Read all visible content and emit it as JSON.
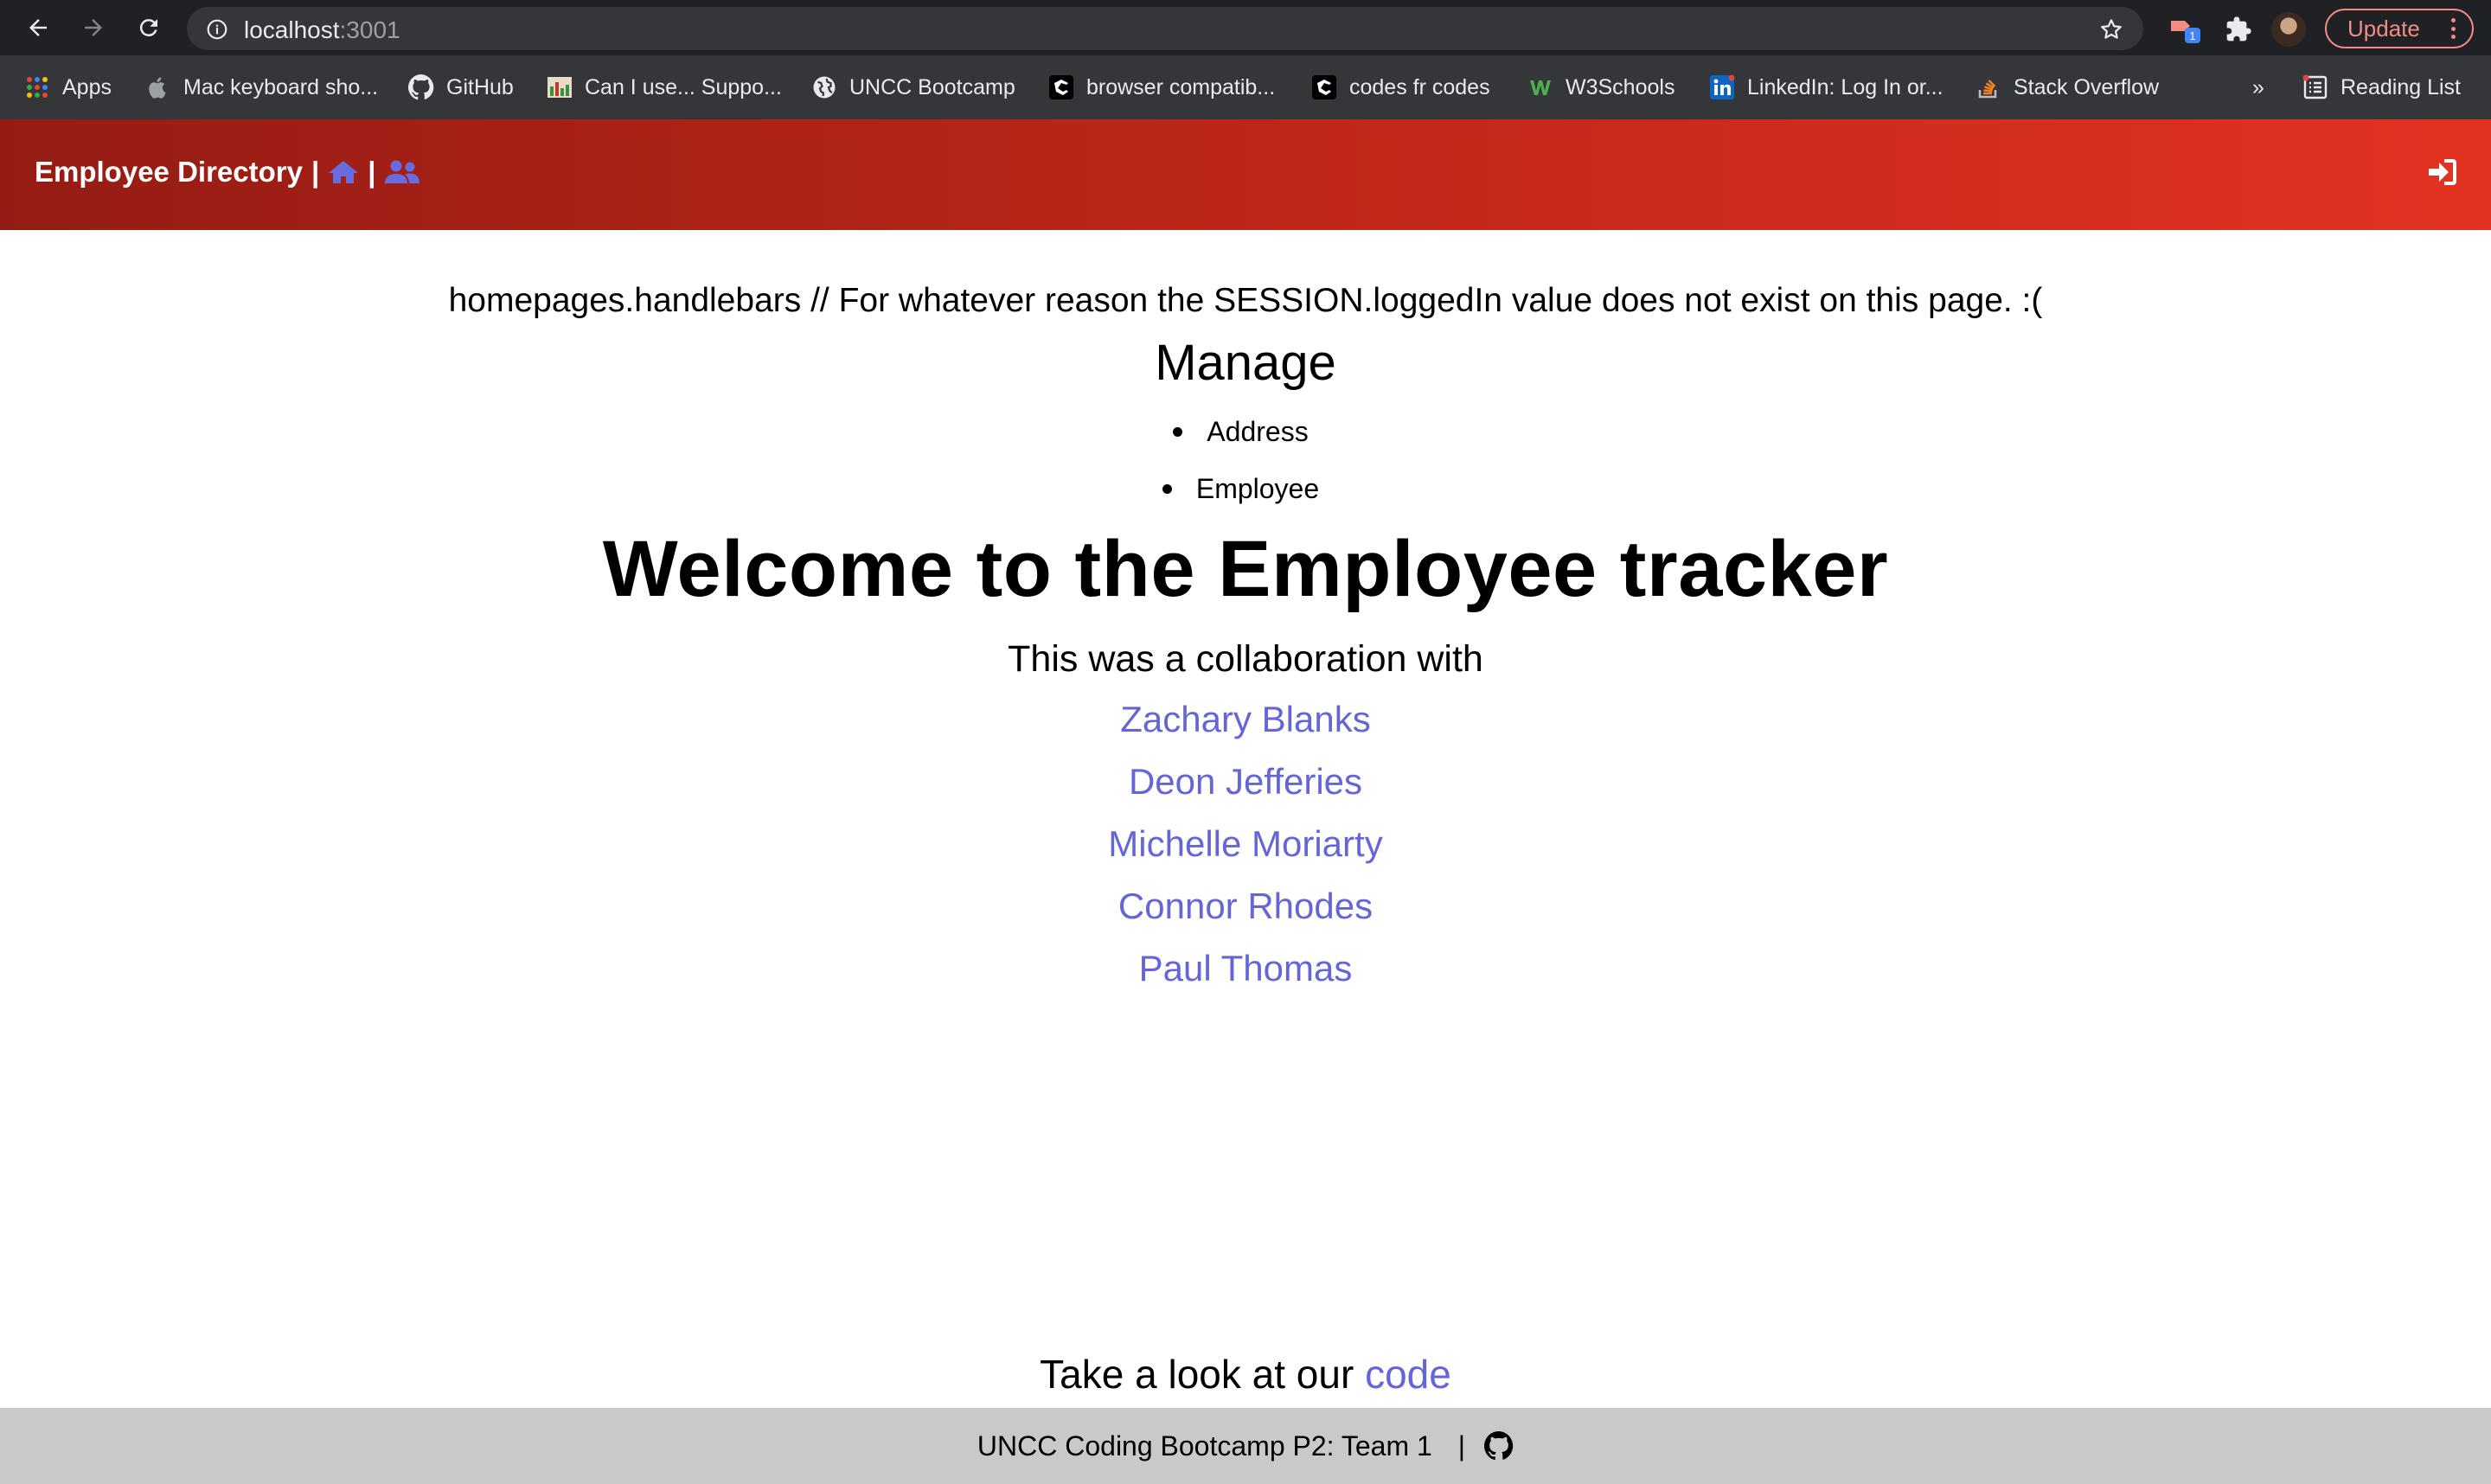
{
  "browser": {
    "url_host": "localhost",
    "url_port": ":3001",
    "update_label": "Update",
    "extension_badge": "1",
    "bookmarks": [
      {
        "label": "Apps",
        "icon": "apps-grid-icon"
      },
      {
        "label": "Mac keyboard sho...",
        "icon": "apple-icon"
      },
      {
        "label": "GitHub",
        "icon": "github-icon"
      },
      {
        "label": "Can I use... Suppo...",
        "icon": "caniuse-icon"
      },
      {
        "label": "UNCC Bootcamp",
        "icon": "globe-icon"
      },
      {
        "label": "browser compatib...",
        "icon": "page-icon"
      },
      {
        "label": "codes fr codes",
        "icon": "page-icon"
      },
      {
        "label": "W3Schools",
        "icon": "w3schools-icon"
      },
      {
        "label": "LinkedIn: Log In or...",
        "icon": "linkedin-icon"
      },
      {
        "label": "Stack Overflow",
        "icon": "stackoverflow-icon"
      }
    ],
    "overflow_label": "»",
    "reading_list_label": "Reading List"
  },
  "navbar": {
    "brand": "Employee Directory",
    "separator": "|",
    "colors": {
      "gradient_start": "#951c14",
      "gradient_end": "#e33222",
      "icon": "#6b6be0"
    }
  },
  "main": {
    "note": "homepages.handlebars // For whatever reason the SESSION.loggedIn value does not exist on this page. :(",
    "manage_heading": "Manage",
    "manage_items": [
      "Address",
      "Employee"
    ],
    "welcome": "Welcome to the Employee tracker",
    "collab_text": "This was a collaboration with",
    "contributors": [
      "Zachary Blanks",
      "Deon Jefferies",
      "Michelle Moriarty",
      "Connor Rhodes",
      "Paul Thomas"
    ],
    "look_text": "Take a look at our ",
    "code_link": "code",
    "link_color": "#6466d8"
  },
  "footer": {
    "text": "UNCC Coding Bootcamp P2: Team 1",
    "separator": "|",
    "icon": "github-icon"
  }
}
